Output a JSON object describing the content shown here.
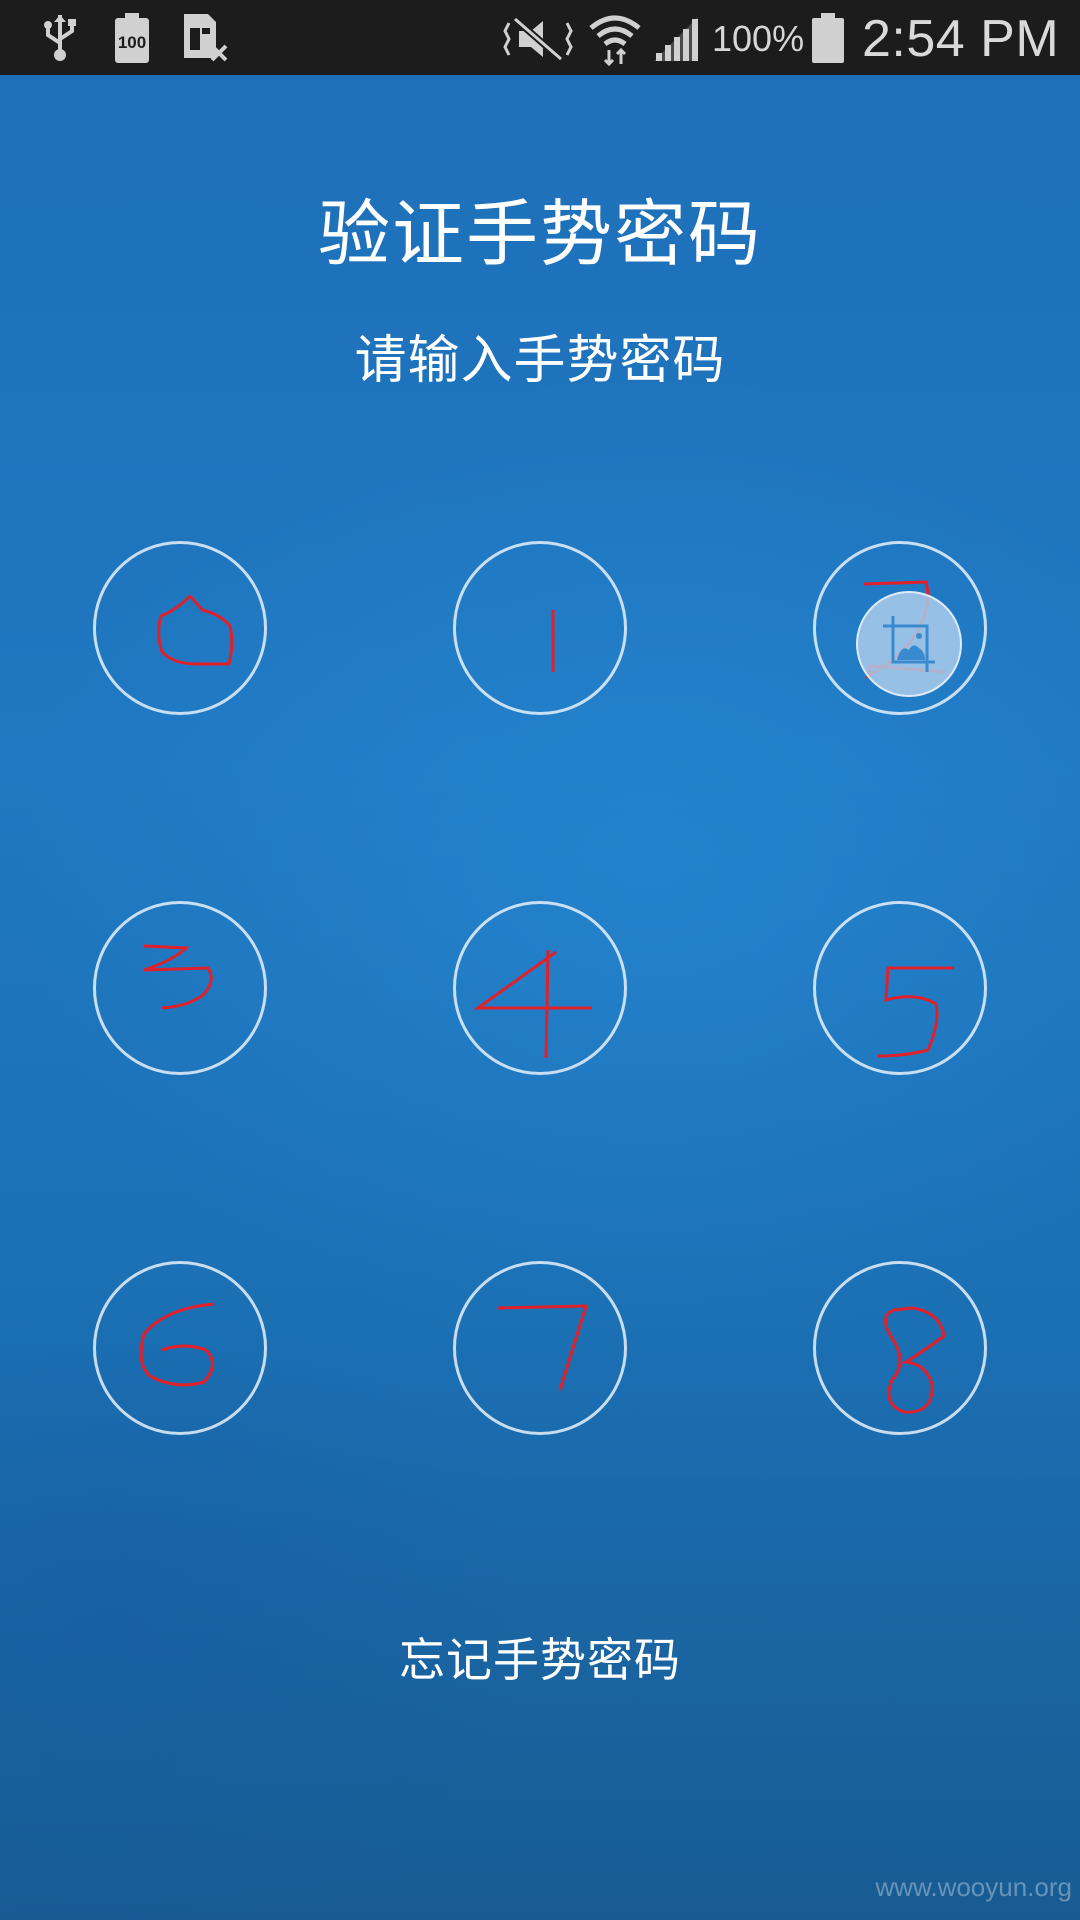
{
  "status_bar": {
    "battery_percent": "100%",
    "time": "2:54 PM",
    "small_battery_label": "100",
    "icons": [
      "usb-icon",
      "battery-saver-icon",
      "sim-card-missing-icon",
      "vibrate-mute-icon",
      "wifi-icon",
      "cell-signal-icon",
      "battery-icon"
    ]
  },
  "screen": {
    "title": "验证手势密码",
    "subtitle": "请输入手势密码",
    "forgot_link": "忘记手势密码"
  },
  "pattern_grid": {
    "rows": 3,
    "columns": 3,
    "node_annotations": [
      "0",
      "1",
      "2",
      "3",
      "4",
      "5",
      "6",
      "7",
      "8"
    ],
    "annotation_color": "#e0202a",
    "active_node": "2",
    "touch_indicator_icon": "image-crop-icon"
  },
  "watermark": "www.wooyun.org",
  "colors": {
    "background": "#1f74bd",
    "status_bar": "#1c1c1c",
    "ring": "#e6f0fa"
  }
}
